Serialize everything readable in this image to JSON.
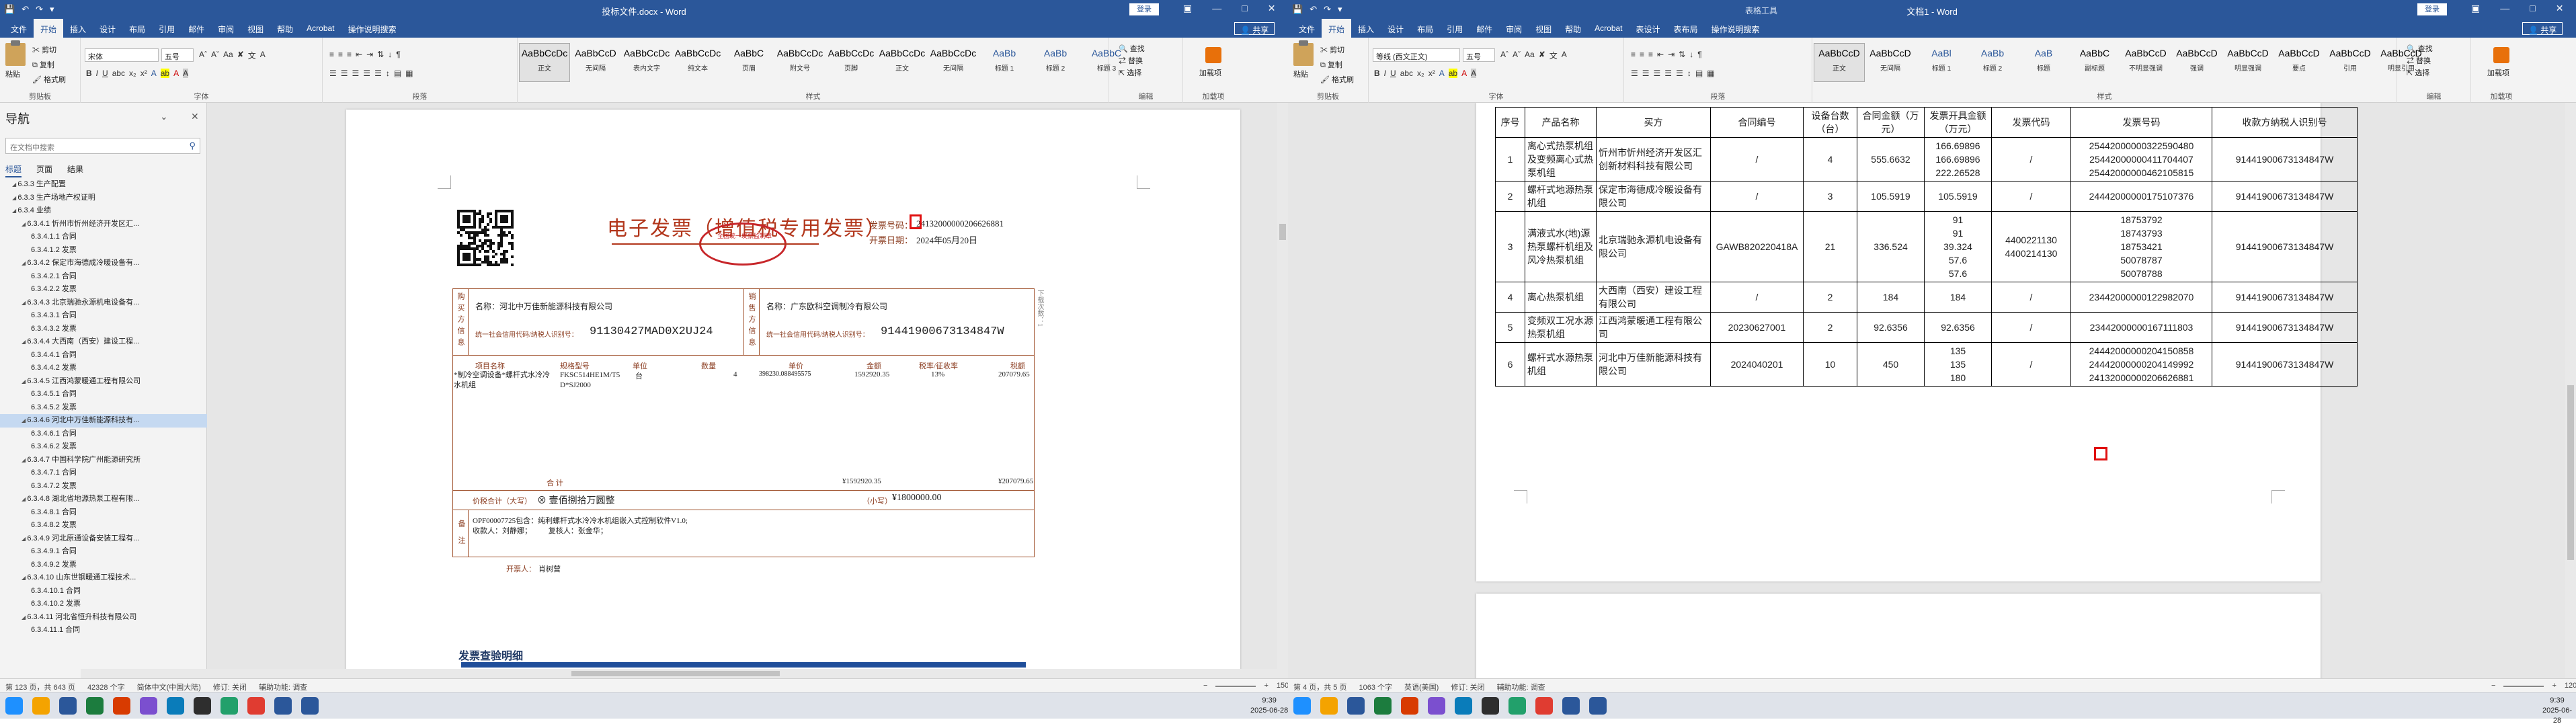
{
  "left": {
    "title": "投标文件.docx - Word",
    "login": "登录",
    "share": "共享",
    "tabs": [
      "文件",
      "开始",
      "插入",
      "设计",
      "布局",
      "引用",
      "邮件",
      "审阅",
      "视图",
      "帮助",
      "Acrobat",
      "操作说明搜索"
    ],
    "ribbon": {
      "paste": "粘贴",
      "cut": "剪切",
      "copy": "复制",
      "format_painter": "格式刷",
      "font_name": "宋体",
      "font_size": "五号",
      "groups": [
        "剪贴板",
        "字体",
        "段落",
        "样式",
        "编辑",
        "加载项"
      ],
      "styles": [
        {
          "preview": "AaBbCcDc",
          "name": "正文"
        },
        {
          "preview": "AaBbCcD",
          "name": "无间隔"
        },
        {
          "preview": "AaBbCcDc",
          "name": "表内文字"
        },
        {
          "preview": "AaBbCcDc",
          "name": "纯文本"
        },
        {
          "preview": "AaBbC",
          "name": "页眉"
        },
        {
          "preview": "AaBbCcDc",
          "name": "附文号"
        },
        {
          "preview": "AaBbCcDc",
          "name": "页脚"
        },
        {
          "preview": "AaBbCcDc",
          "name": "正文"
        },
        {
          "preview": "AaBbCcDc",
          "name": "无间隔"
        },
        {
          "preview": "AaBb",
          "name": "标题 1"
        },
        {
          "preview": "AaBb",
          "name": "标题 2"
        },
        {
          "preview": "AaBbC",
          "name": "标题 3"
        }
      ],
      "edit": [
        "查找",
        "替换",
        "选择"
      ],
      "addin": "加载项"
    },
    "nav": {
      "title": "导航",
      "search_placeholder": "在文档中搜索",
      "tabs": [
        "标题",
        "页面",
        "结果"
      ],
      "items": [
        "6.3.3 生产配置",
        "6.3.3 生产场地产权证明",
        "6.3.4 业绩",
        "6.3.4.1 忻州市忻州经济开发区汇...",
        "6.3.4.1.1 合同",
        "6.3.4.1.2 发票",
        "6.3.4.2 保定市海德成冷暖设备有...",
        "6.3.4.2.1 合同",
        "6.3.4.2.2 发票",
        "6.3.4.3 北京瑞驰永源机电设备有...",
        "6.3.4.3.1 合同",
        "6.3.4.3.2 发票",
        "6.3.4.4 大西南（西安）建设工程...",
        "6.3.4.4.1 合同",
        "6.3.4.4.2 发票",
        "6.3.4.5 江西鸿蒙暖通工程有限公司",
        "6.3.4.5.1 合同",
        "6.3.4.5.2 发票",
        "6.3.4.6 河北中万佳新能源科技有...",
        "6.3.4.6.1 合同",
        "6.3.4.6.2 发票",
        "6.3.4.7 中国科学院广州能源研究所",
        "6.3.4.7.1 合同",
        "6.3.4.7.2 发票",
        "6.3.4.8 湖北省地源热泵工程有限...",
        "6.3.4.8.1 合同",
        "6.3.4.8.2 发票",
        "6.3.4.9 河北原通设备安装工程有...",
        "6.3.4.9.1 合同",
        "6.3.4.9.2 发票",
        "6.3.4.10 山东世钢暖通工程技术...",
        "6.3.4.10.1 合同",
        "6.3.4.10.2 发票",
        "6.3.4.11 河北省恒升科技有限公司",
        "6.3.4.11.1 合同"
      ],
      "selected_index": 18
    },
    "invoice": {
      "title": "电子发票（增值税专用发票）",
      "number_label": "发票号码：",
      "number": "24132000000206626881",
      "date_label": "开票日期：",
      "date": "2024年05月20日",
      "seal_text": "全国统一发票监制章",
      "buyer_vlabel": "购买方信息",
      "seller_vlabel": "销售方信息",
      "buyer_name": "名称：河北中万佳新能源科技有限公司",
      "buyer_id_label": "统一社会信用代码/纳税人识别号：",
      "buyer_id": "91130427MAD0X2UJ24",
      "seller_name": "名称：广东欧科空调制冷有限公司",
      "seller_id_label": "统一社会信用代码/纳税人识别号：",
      "seller_id": "91441900673134847W",
      "headers": [
        "项目名称",
        "规格型号",
        "单位",
        "数量",
        "单价",
        "金额",
        "税率/征收率",
        "税额"
      ],
      "item_name": "*制冷空调设备*螺杆式水冷冷水机组",
      "item_spec": "FKSC514HE1M/T5 D*SJ2000",
      "item_unit": "台",
      "item_qty": "4",
      "item_price": "398230.088495575",
      "item_amount": "1592920.35",
      "item_rate": "13%",
      "item_tax": "207079.65",
      "total_label": "合 计",
      "total_amount": "¥1592920.35",
      "total_tax": "¥207079.65",
      "grand_label": "价税合计（大写）",
      "grand_words": "壹佰捌拾万圆整",
      "grand_small_label": "（小写）",
      "grand_small": "¥1800000.00",
      "remark_label": "备注",
      "remark1": "OPF00007725包含：纯利螺杆式水冷冷水机组嵌入式控制软件V1.0;",
      "remark2": "收款人：刘静娜；         复核人：张金华；",
      "issuer_label": "开票人：",
      "issuer": "肖树营",
      "side_note": "下载次数：1",
      "bottom_heading": "发票查验明细"
    },
    "status": {
      "page": "第 123 页，共 643 页",
      "words": "42328 个字",
      "lang": "简体中文(中国大陆)",
      "revise": "修订: 关闭",
      "access": "辅助功能: 调查",
      "zoom": "150%"
    }
  },
  "right": {
    "title": "文档1 - Word",
    "table_tools": "表格工具",
    "login": "登录",
    "share": "共享",
    "tabs": [
      "文件",
      "开始",
      "插入",
      "设计",
      "布局",
      "引用",
      "邮件",
      "审阅",
      "视图",
      "帮助",
      "Acrobat",
      "表设计",
      "表布局",
      "操作说明搜索"
    ],
    "ribbon": {
      "paste": "粘贴",
      "cut": "剪切",
      "copy": "复制",
      "format_painter": "格式刷",
      "font_name": "等线 (西文正文)",
      "font_size": "五号",
      "groups": [
        "剪贴板",
        "字体",
        "段落",
        "样式",
        "编辑",
        "加载项"
      ],
      "styles": [
        {
          "preview": "AaBbCcD",
          "name": "正文"
        },
        {
          "preview": "AaBbCcD",
          "name": "无间隔"
        },
        {
          "preview": "AaBl",
          "name": "标题 1"
        },
        {
          "preview": "AaBb",
          "name": "标题 2"
        },
        {
          "preview": "AaB",
          "name": "标题"
        },
        {
          "preview": "AaBbC",
          "name": "副标题"
        },
        {
          "preview": "AaBbCcD",
          "name": "不明显强调"
        },
        {
          "preview": "AaBbCcD",
          "name": "强调"
        },
        {
          "preview": "AaBbCcD",
          "name": "明显强调"
        },
        {
          "preview": "AaBbCcD",
          "name": "要点"
        },
        {
          "preview": "AaBbCcD",
          "name": "引用"
        },
        {
          "preview": "AaBbCcD",
          "name": "明显引用"
        }
      ],
      "edit": [
        "查找",
        "替换",
        "选择"
      ],
      "addin": "加载项"
    },
    "table": {
      "headers": [
        "序号",
        "产品名称",
        "买方",
        "合同编号",
        "设备台数（台）",
        "合同金额（万元）",
        "发票开具金额（万元）",
        "发票代码",
        "发票号码",
        "收款方纳税人识别号"
      ],
      "rows": [
        [
          "1",
          "离心式热泵机组及变频离心式热泵机组",
          "忻州市忻州经济开发区汇创新材料科技有限公司",
          "/",
          "4",
          "555.6632",
          "166.69896\n166.69896\n222.26528",
          "/",
          "25442000000322590480\n25442000000411704407\n25442000000462105815",
          "91441900673134847W"
        ],
        [
          "2",
          "螺杆式地源热泵机组",
          "保定市海德成冷暖设备有限公司",
          "/",
          "3",
          "105.5919",
          "105.5919",
          "/",
          "24442000000175107376",
          "91441900673134847W"
        ],
        [
          "3",
          "满液式水(地)源热泵螺杆机组及风冷热泵机组",
          "北京瑞驰永源机电设备有限公司",
          "GAWB820220418A",
          "21",
          "336.524",
          "91\n91\n39.324\n57.6\n57.6",
          "4400221130\n4400214130",
          "18753792\n18743793\n18753421\n50078787\n50078788",
          "91441900673134847W"
        ],
        [
          "4",
          "离心热泵机组",
          "大西南（西安）建设工程有限公司",
          "/",
          "2",
          "184",
          "184",
          "/",
          "23442000000122982070",
          "91441900673134847W"
        ],
        [
          "5",
          "变频双工况水源热泵机组",
          "江西鸿蒙暖通工程有限公司",
          "20230627001",
          "2",
          "92.6356",
          "92.6356",
          "/",
          "23442000000167111803",
          "91441900673134847W"
        ],
        [
          "6",
          "螺杆式水源热泵机组",
          "河北中万佳新能源科技有限公司",
          "2024040201",
          "10",
          "450",
          "135\n135\n180",
          "/",
          "24442000000204150858\n24442000000204149992\n24132000000206626881",
          "91441900673134847W"
        ]
      ]
    },
    "status": {
      "page": "第 4 页，共 5 页",
      "words": "1063 个字",
      "lang": "英语(美国)",
      "revise": "修订: 关闭",
      "access": "辅助功能: 调查",
      "zoom": "120%"
    }
  },
  "taskbar": {
    "time": "9:39",
    "date": "2025-06-28"
  }
}
